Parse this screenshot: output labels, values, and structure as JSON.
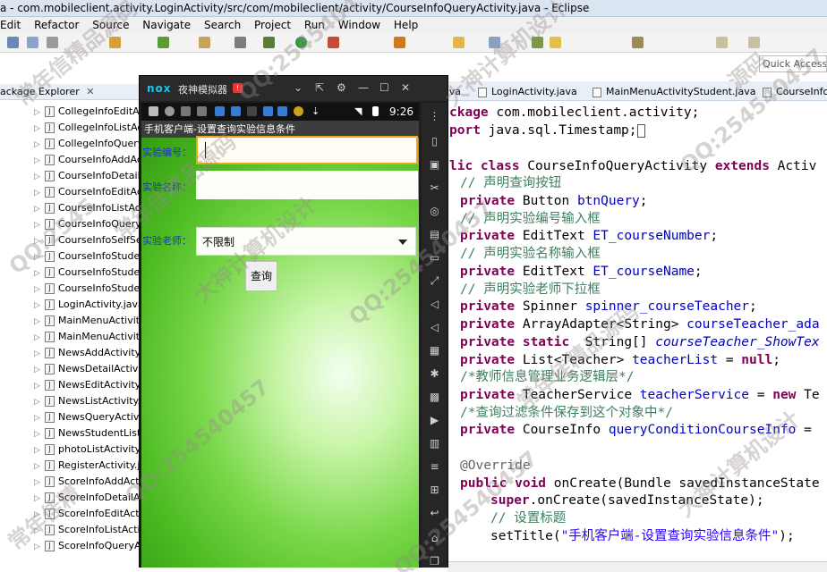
{
  "window": {
    "title": "a - com.mobileclient.activity.LoginActivity/src/com/mobileclient/activity/CourseInfoQueryActivity.java - Eclipse"
  },
  "menu": [
    "Edit",
    "Refactor",
    "Source",
    "Navigate",
    "Search",
    "Project",
    "Run",
    "Window",
    "Help"
  ],
  "quick_access": "Quick Access",
  "package_explorer": {
    "title": "ackage Explorer",
    "items": [
      "CollegeInfoEditAc",
      "CollegeInfoListAct",
      "CollegeInfoQuery",
      "CourseInfoAddAct",
      "CourseInfoDetail",
      "CourseInfoEditAct",
      "CourseInfoListAct",
      "CourseInfoQuery",
      "CourseInfoSelfSe",
      "CourseInfoStuder",
      "CourseInfoStuder",
      "CourseInfoStuder",
      "LoginActivity.java",
      "MainMenuActivity",
      "MainMenuActivity",
      "NewsAddActivity.j",
      "NewsDetailActivit",
      "NewsEditActivity.j",
      "NewsListActivity.j",
      "NewsQueryActivi",
      "NewsStudentList",
      "photoListActivity.j",
      "RegisterActivity.ja",
      "ScoreInfoAddAct",
      "ScoreInfoDetailA",
      "ScoreInfoEditActi",
      "ScoreInfoListActi",
      "ScoreInfoQueryA"
    ]
  },
  "editor_tabs": [
    "Util.java",
    "LoginActivity.java",
    "MainMenuActivityStudent.java",
    "CourseInfo"
  ],
  "emulator": {
    "brand": "nox",
    "title": "夜神模拟器",
    "badge": "!",
    "controls": [
      "⌄",
      "⇱",
      "⚙",
      "—",
      "☐",
      "✕"
    ],
    "clock": "9:26",
    "app_title": "手机客户端-设置查询实验信息条件",
    "fields": {
      "course_number_label": "实验编号：",
      "course_name_label": "实验名称：",
      "teacher_label": "实验老师：",
      "teacher_selected": "不限制",
      "query_button": "查询"
    }
  },
  "code": {
    "l1_kw": "ckage",
    "l1_rest": " com.mobileclient.activity;",
    "l2_kw": "port",
    "l2_rest": " java.sql.Timestamp;",
    "l3_kw1": "lic class",
    "l3_name": " CourseInfoQueryActivity ",
    "l3_kw2": "extends",
    "l3_rest": " Activ",
    "c1": "// 声明查询按钮",
    "p1": "private",
    "p1t": " Button ",
    "p1f": "btnQuery",
    "p1e": ";",
    "c2": "// 声明实验编号输入框",
    "p2": "private",
    "p2t": " EditText ",
    "p2f": "ET_courseNumber",
    "p2e": ";",
    "c3": "// 声明实验名称输入框",
    "p3": "private",
    "p3t": " EditText ",
    "p3f": "ET_courseName",
    "p3e": ";",
    "c4": "// 声明实验老师下拉框",
    "p4": "private",
    "p4t": " Spinner ",
    "p4f": "spinner_courseTeacher",
    "p4e": ";",
    "p5": "private",
    "p5t": " ArrayAdapter<String> ",
    "p5f": "courseTeacher_ada",
    "p6": "private static",
    "p6t": "  String[] ",
    "p6f": "courseTeacher_ShowTex",
    "p7": "private",
    "p7t": " List<Teacher> ",
    "p7f": "teacherList",
    "p7m": " = ",
    "p7n": "null",
    "p7e": ";",
    "c5": "/*教师信息管理业务逻辑层*/",
    "p8": "private",
    "p8t": " TeacherService ",
    "p8f": "teacherService",
    "p8m": " = ",
    "p8n": "new",
    "p8r": " Te",
    "c6": "/*查询过滤条件保存到这个对象中*/",
    "p9": "private",
    "p9t": " CourseInfo ",
    "p9f": "queryConditionCourseInfo",
    "p9e": " =",
    "ov": "@Override",
    "m1": "public void",
    "m1r": " onCreate(Bundle savedInstanceState",
    "m2": "super",
    "m2r": ".onCreate(savedInstanceState);",
    "c7": "// 设置标题",
    "m3": "setTitle(",
    "m3s": "\"手机客户端-设置查询实验信息条件\"",
    "m3e": ");"
  },
  "watermarks": [
    "常年信精品源码",
    "QQ:2545404",
    "大神计算机设计",
    "QQ:254540457",
    "常年佳精品源码",
    "QQ:254540457",
    "大神计算机设计",
    "QQ:2545",
    "常年佳精品源码",
    "大神计算机设计",
    "QQ:254540457",
    "常年佳精",
    "QQ:254540457",
    "源码"
  ]
}
